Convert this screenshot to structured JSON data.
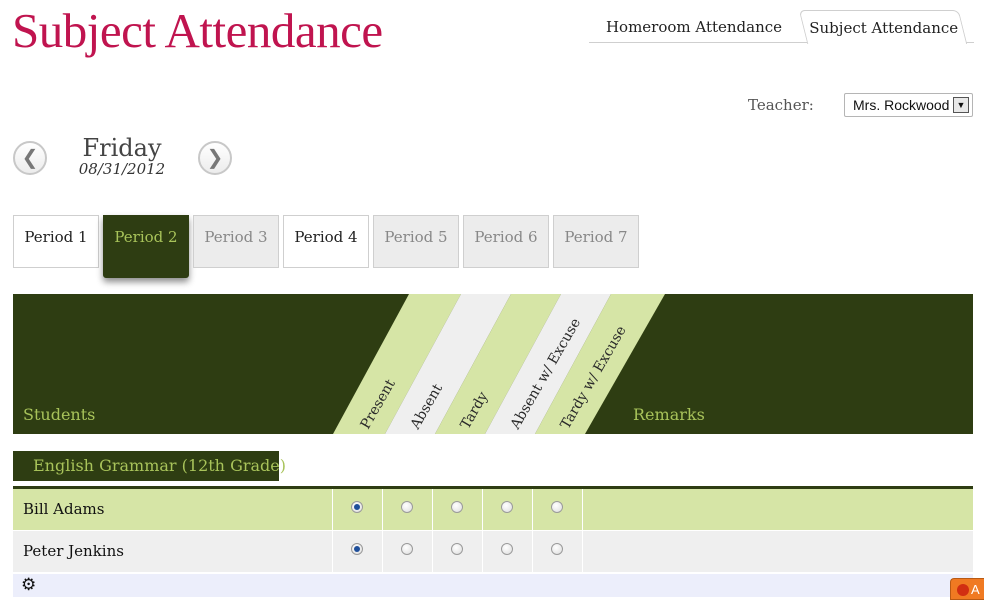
{
  "page": {
    "title": "Subject Attendance"
  },
  "top_tabs": [
    {
      "label": "Homeroom Attendance",
      "active": false
    },
    {
      "label": "Subject Attendance",
      "active": true
    }
  ],
  "teacher": {
    "label": "Teacher:",
    "selected": "Mrs. Rockwood"
  },
  "day_nav": {
    "day": "Friday",
    "date": "08/31/2012",
    "prev_icon": "chevron-left-icon",
    "next_icon": "chevron-right-icon"
  },
  "periods": [
    {
      "label": "Period 1",
      "state": "available"
    },
    {
      "label": "Period 2",
      "state": "active"
    },
    {
      "label": "Period 3",
      "state": "disabled"
    },
    {
      "label": "Period 4",
      "state": "available"
    },
    {
      "label": "Period 5",
      "state": "disabled"
    },
    {
      "label": "Period 6",
      "state": "disabled"
    },
    {
      "label": "Period 7",
      "state": "disabled"
    }
  ],
  "table_header": {
    "students": "Students",
    "remarks": "Remarks",
    "statuses": [
      "Present",
      "Absent",
      "Tardy",
      "Absent w/ Excuse",
      "Tardy w/ Excuse"
    ]
  },
  "course": {
    "name": "English Grammar (12th Grade)"
  },
  "students": [
    {
      "name": "Bill Adams",
      "selected_status": "Present"
    },
    {
      "name": "Peter Jenkins",
      "selected_status": "Present"
    }
  ],
  "footer": {
    "settings_icon": "gear-icon"
  },
  "corner_badge": {
    "text": "A"
  },
  "colors": {
    "title": "#c0144f",
    "dark_green": "#2e3d12",
    "accent_green": "#a8c35a",
    "light_green": "#d6e5a6",
    "row_gray": "#efefef",
    "footer": "#eceefb"
  }
}
